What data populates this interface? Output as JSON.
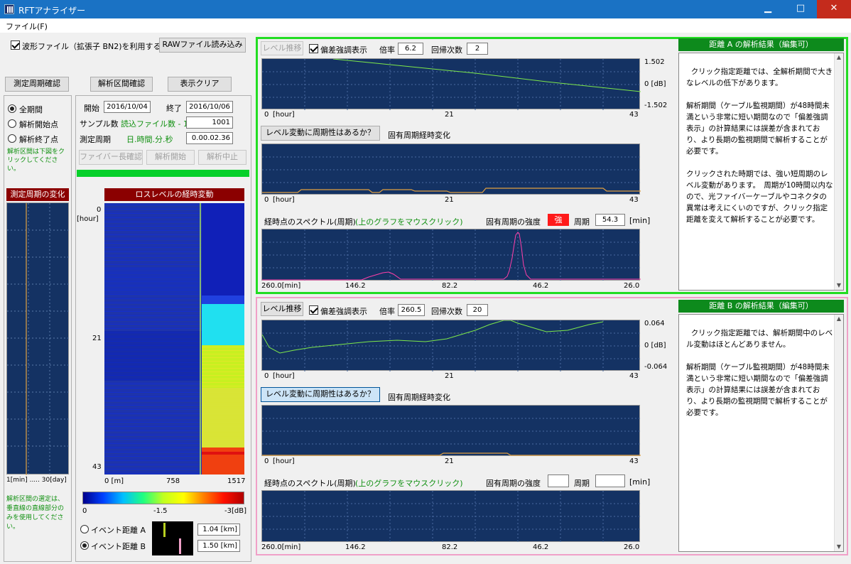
{
  "window": {
    "title": "RFTアナライザー",
    "min": "▁",
    "max": "□",
    "close": "✕"
  },
  "menu": {
    "file": "ファイル(F)"
  },
  "top": {
    "use_waveform": "波形ファイル（拡張子 BN2)を利用する",
    "raw_read": "RAWファイル読み込み"
  },
  "left": {
    "measure_confirm": "測定周期確認",
    "options": [
      "全期間",
      "解析開始点",
      "解析終了点"
    ],
    "hint": "解析区間は下図をクリックしてください。",
    "cycle_header": "測定周期の変化",
    "range": "1[min] ..... 30[day]",
    "note": "解析区間の選定は、垂直線の直線部分のみを使用してください。"
  },
  "mid": {
    "analysis_confirm": "解析区間確認",
    "clear": "表示クリア",
    "start_label": "開始",
    "start": "2016/10/04",
    "end_label": "終了",
    "end": "2016/10/06",
    "samples_label": "サンプル数",
    "samples_note": "読込ファイル数 - 1",
    "samples": "1001",
    "period_label": "測定周期",
    "period_note": "日.時間.分.秒",
    "period": "0.00.02.36",
    "fiber": "ファイバー長確認",
    "analyze_start": "解析開始",
    "analyze_stop": "解析中止",
    "heatmap_title": "ロスレベルの経時変動",
    "hour_unit": "[hour]",
    "y_ticks": [
      "0",
      "21",
      "43"
    ],
    "x_ticks": [
      "0 [m]",
      "758",
      "1517"
    ],
    "cb_ticks": [
      "0",
      "-1.5",
      "-3[dB]"
    ],
    "event_a": "イベント距離 A",
    "event_b": "イベント距離 B",
    "event_a_val": "1.04 [km]",
    "event_b_val": "1.50 [km]"
  },
  "secA": {
    "level_btn": "レベル推移",
    "emph": "偏差強調表示",
    "mag_label": "倍率",
    "mag": "6.2",
    "reg_label": "回帰次数",
    "reg": "2",
    "y_top": "1.502",
    "y_mid": "0 [dB]",
    "y_bot": "-1.502",
    "x0": "0",
    "xunit": "[hour]",
    "x21": "21",
    "x43": "43",
    "periodic_btn": "レベル変動に周期性はあるか？",
    "periodic_label": "固有周期経時変化",
    "spec_label": "経時点のスペクトル(周期)",
    "spec_note": "(上のグラフをマウスクリック)",
    "strength_label": "固有周期の強度",
    "strength": "強",
    "period_label": "周期",
    "period": "54.3",
    "period_unit": "[min]",
    "sx": [
      "260.0[min]",
      "146.2",
      "82.2",
      "46.2",
      "26.0"
    ],
    "result_title": "距離 A の解析結果（編集可）",
    "result": "クリック指定距離では、全解析期間で大きなレベルの低下があります。\n\n解析期間（ケーブル監視期間）が48時間未満という非常に短い期間なので「偏差強調表示」の計算結果には誤差が含まれており、より長期の監視期間で解析することが必要です。\n\nクリックされた時期では、強い短周期のレベル変動があります。　周期が10時間以内なので、光ファイバーケーブルやコネクタの異常は考えにくいのですが、クリック指定距離を変えて解析することが必要です。"
  },
  "secB": {
    "level_btn": "レベル推移",
    "emph": "偏差強調表示",
    "mag_label": "倍率",
    "mag": "260.5",
    "reg_label": "回帰次数",
    "reg": "20",
    "y_top": "0.064",
    "y_mid": "0 [dB]",
    "y_bot": "-0.064",
    "x0": "0",
    "xunit": "[hour]",
    "x21": "21",
    "x43": "43",
    "periodic_btn": "レベル変動に周期性はあるか？",
    "periodic_label": "固有周期経時変化",
    "spec_label": "経時点のスペクトル(周期)",
    "spec_note": "(上のグラフをマウスクリック)",
    "strength_label": "固有周期の強度",
    "period_label": "周期",
    "period_unit": "[min]",
    "sx": [
      "260.0[min]",
      "146.2",
      "82.2",
      "46.2",
      "26.0"
    ],
    "result_title": "距離 B の解析結果（編集可）",
    "result": "クリック指定距離では、解析期間中のレベル変動はほとんどありません。\n\n解析期間（ケーブル監視期間）が48時間未満という非常に短い期間なので「偏差強調表示」の計算結果には誤差が含まれており、より長期の監視期間で解析することが必要です。"
  },
  "colors": {
    "plot_bg": "#143263",
    "green_frame": "#22dd22",
    "pink_frame": "#f0a0c8",
    "trend": "#7ee84a",
    "spectrum": "#ff3fa8",
    "periodic": "#e0a040"
  }
}
